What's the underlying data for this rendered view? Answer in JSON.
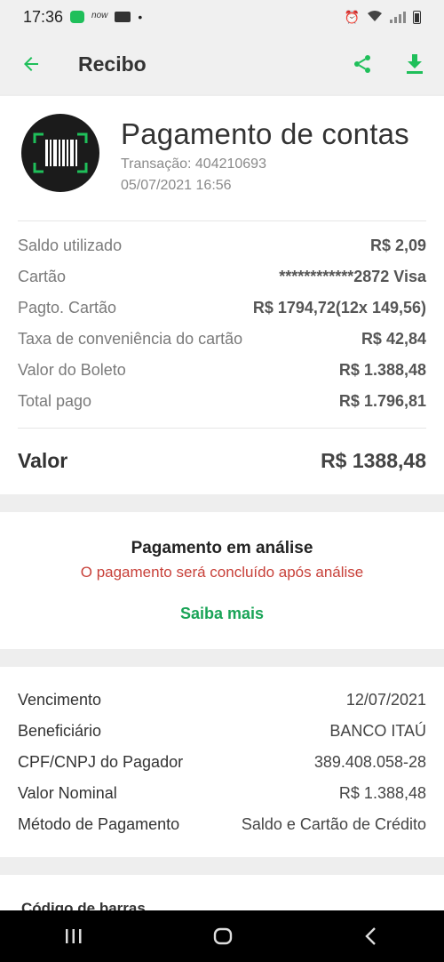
{
  "status_bar": {
    "time": "17:36",
    "app_label": "now"
  },
  "appbar": {
    "title": "Recibo",
    "icons": [
      "arrow-left-icon",
      "share-icon",
      "download-icon"
    ],
    "accent": "#1fbf5a"
  },
  "receipt": {
    "title": "Pagamento de contas",
    "transaction": "Transação: 404210693",
    "datetime": "05/07/2021 16:56",
    "rows": [
      {
        "label": "Saldo utilizado",
        "value": "R$ 2,09"
      },
      {
        "label": "Cartão",
        "value": "************2872 Visa"
      },
      {
        "label": "Pagto. Cartão",
        "value": "R$ 1794,72(12x 149,56)"
      },
      {
        "label": "Taxa de conveniência do cartão",
        "value": "R$ 42,84"
      },
      {
        "label": "Valor do Boleto",
        "value": "R$ 1.388,48"
      },
      {
        "label": "Total pago",
        "value": "R$ 1.796,81"
      }
    ],
    "total_label": "Valor",
    "total_value": "R$ 1388,48"
  },
  "analysis": {
    "title": "Pagamento em análise",
    "subtitle": "O pagamento será concluído após análise",
    "link": "Saiba mais"
  },
  "details": {
    "rows": [
      {
        "label": "Vencimento",
        "value": "12/07/2021"
      },
      {
        "label": "Beneficiário",
        "value": "BANCO ITAÚ"
      },
      {
        "label": "CPF/CNPJ do Pagador",
        "value": "389.408.058-28"
      },
      {
        "label": "Valor Nominal",
        "value": "R$ 1.388,48"
      },
      {
        "label": "Método de Pagamento",
        "value": "Saldo e Cartão de Crédito"
      }
    ]
  },
  "barcode_section": {
    "label": "Código de barras"
  }
}
